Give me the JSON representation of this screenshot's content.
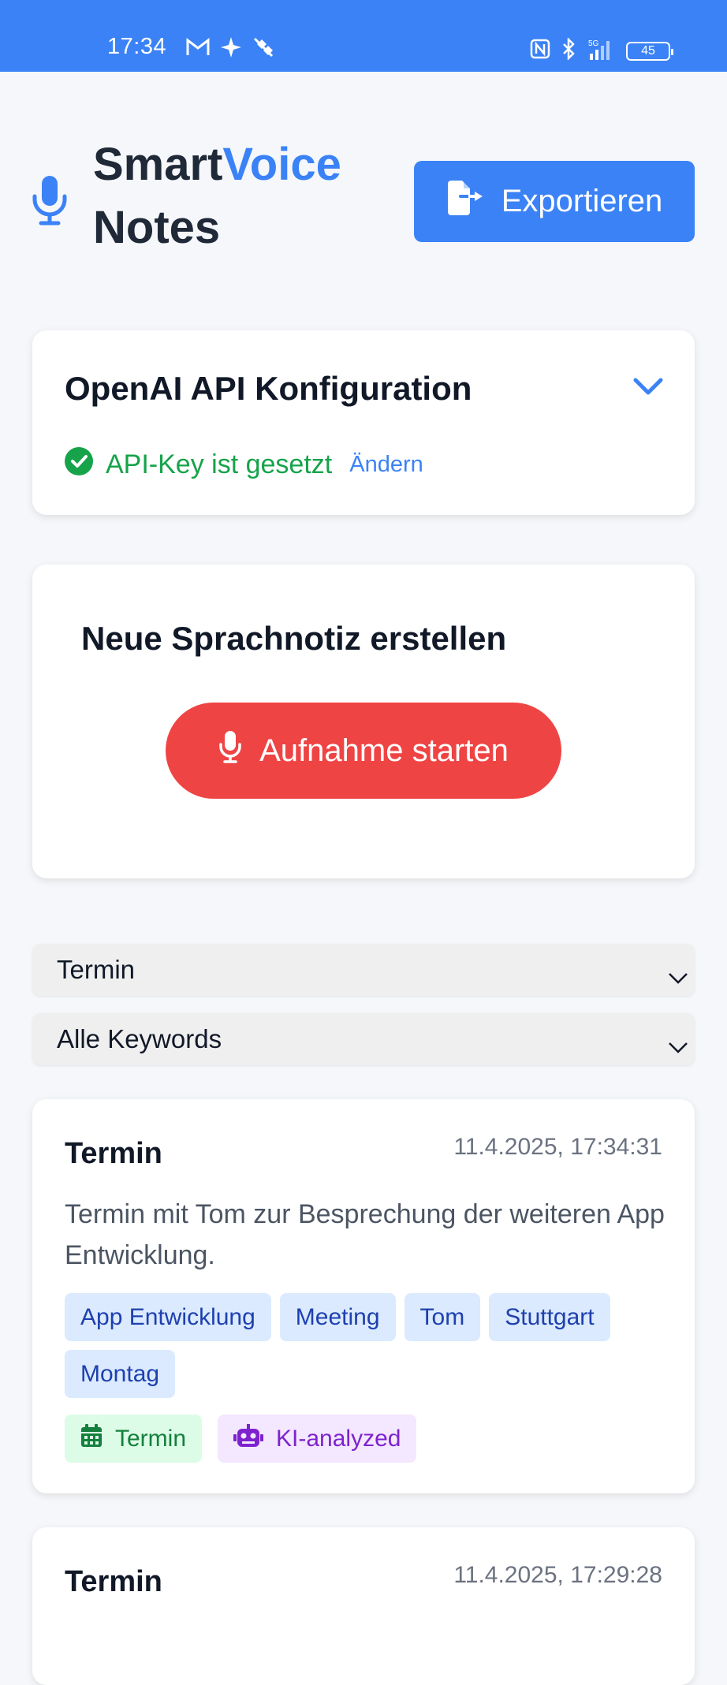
{
  "status_bar": {
    "time": "17:34",
    "battery": "45",
    "left_icons": [
      "gmail-icon",
      "sparkle-icon",
      "satellite-off-icon"
    ],
    "right_icons": [
      "nfc-icon",
      "bluetooth-icon",
      "signal-5g-icon",
      "battery-icon"
    ]
  },
  "header": {
    "title_part1": "Smart",
    "title_part2": "Voice",
    "title_part3": "Notes",
    "export_label": "Exportieren"
  },
  "api_config": {
    "title": "OpenAI API Konfiguration",
    "status_text": "API-Key ist gesetzt",
    "change_label": "Ändern"
  },
  "recording": {
    "title": "Neue Sprachnotiz erstellen",
    "button_label": "Aufnahme starten"
  },
  "filters": {
    "category_selected": "Termin",
    "keyword_selected": "Alle Keywords"
  },
  "notes": [
    {
      "title": "Termin",
      "date": "11.4.2025, 17:34:31",
      "text": "Termin mit Tom zur Besprechung der weiteren App Entwicklung.",
      "keywords": [
        "App Entwicklung",
        "Meeting",
        "Tom",
        "Stuttgart",
        "Montag"
      ],
      "category_badge": "Termin",
      "ai_badge": "KI-analyzed"
    },
    {
      "title": "Termin",
      "date": "11.4.2025, 17:29:28"
    }
  ],
  "colors": {
    "primary": "#3b82f6",
    "record": "#ef4444",
    "success": "#16a34a",
    "keyword_bg": "#dbeafe",
    "keyword_text": "#1e40af",
    "badge_green_bg": "#dcfce7",
    "badge_purple_bg": "#f3e8ff"
  }
}
